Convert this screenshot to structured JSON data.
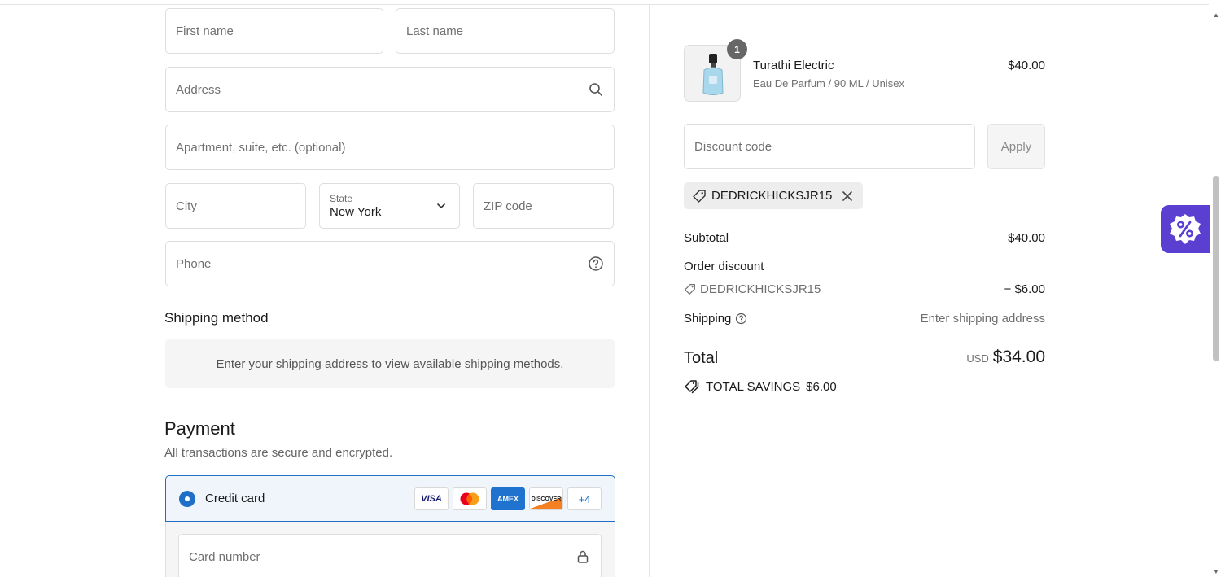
{
  "form": {
    "first_name_placeholder": "First name",
    "last_name_placeholder": "Last name",
    "address_placeholder": "Address",
    "apartment_placeholder": "Apartment, suite, etc. (optional)",
    "city_placeholder": "City",
    "state_label": "State",
    "state_value": "New York",
    "zip_placeholder": "ZIP code",
    "phone_placeholder": "Phone"
  },
  "shipping": {
    "title": "Shipping method",
    "message": "Enter your shipping address to view available shipping methods."
  },
  "payment": {
    "title": "Payment",
    "subtitle": "All transactions are secure and encrypted.",
    "method_label": "Credit card",
    "cards": [
      "VISA",
      "MC",
      "AMEX",
      "DISCOVER"
    ],
    "more_cards": "+4",
    "card_number_placeholder": "Card number"
  },
  "summary": {
    "product": {
      "quantity": "1",
      "name": "Turathi Electric",
      "variant": "Eau De Parfum / 90 ML / Unisex",
      "price": "$40.00"
    },
    "discount_placeholder": "Discount code",
    "apply_label": "Apply",
    "applied_code": "DEDRICKHICKSJR15",
    "subtotal_label": "Subtotal",
    "subtotal_value": "$40.00",
    "order_discount_label": "Order discount",
    "order_discount_code": "DEDRICKHICKSJR15",
    "order_discount_value": "− $6.00",
    "shipping_label": "Shipping",
    "shipping_value": "Enter shipping address",
    "total_label": "Total",
    "total_currency": "USD",
    "total_value": "$34.00",
    "savings_label": "TOTAL SAVINGS",
    "savings_value": "$6.00"
  },
  "colors": {
    "accent": "#1f6fc7",
    "promo": "#5a3fd1"
  }
}
